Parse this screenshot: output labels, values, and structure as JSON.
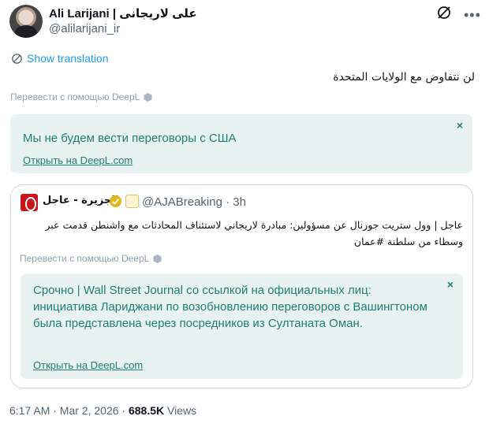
{
  "author": {
    "name": "Ali Larijani | علی لاریجانی",
    "handle": "@alilarijani_ir"
  },
  "show_translation": "Show translation",
  "tweet_text": "لن نتفاوض مع الولايات المتحدة",
  "deepl_label": "Перевести с помощью DeepL",
  "translation_1": {
    "text": "Мы не будем вести переговоры с США",
    "close": "×",
    "open_link": "Открыть на DeepL.com"
  },
  "quote": {
    "name": "الجزيرة - عاجل",
    "handle": "@AJABreaking · 3h",
    "text": "عاجل | وول ستريت جورنال عن مسؤولين: مبادرة لاريجاني لاستئناف المحادثات مع واشنطن قدمت عبر وسطاء من سلطنة #عمان",
    "deepl_label": "Перевести с помощью DeepL",
    "translation": {
      "text": "Срочно | Wall Street Journal со ссылкой на официальных лиц: инициатива Лариджани по возобновлению переговоров с Вашингтоном была представлена через посредников из Султаната Оман.",
      "close": "×",
      "open_link": "Открыть на DeepL.com"
    }
  },
  "footer": {
    "time": "6:17 AM · Mar 2, 2026 · ",
    "views_count": "688.5K",
    "views_label": " Views"
  },
  "colors": {
    "link_blue": "#1d9bf0",
    "translation_bg": "#e8f2f0",
    "translation_text": "#1f7f73",
    "deepl_gray": "#8fa1b0"
  }
}
